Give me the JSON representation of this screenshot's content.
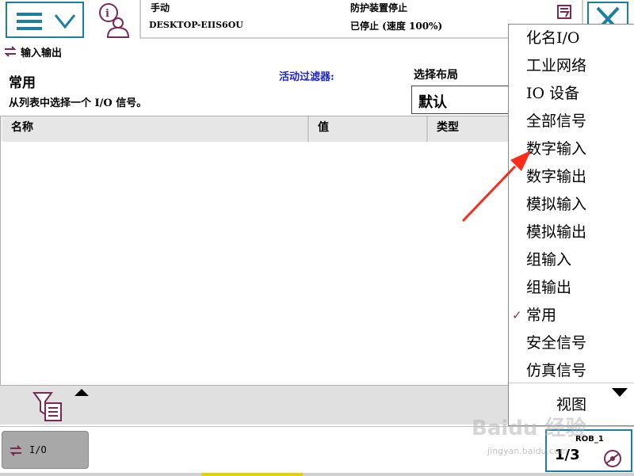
{
  "topbar": {
    "mode": "手动",
    "controller": "DESKTOP-EIIS6OU",
    "protection": "防护装置停止",
    "state_speed": "已停止 (速度 100%)"
  },
  "breadcrumb": {
    "title": "输入输出"
  },
  "header": {
    "view_title": "常用",
    "description": "从列表中选择一个 I/O 信号。",
    "filter_label": "活动过滤器:",
    "layout_label": "选择布局",
    "layout_value": "默认"
  },
  "table": {
    "columns": [
      "名称",
      "值",
      "类型"
    ],
    "rows": []
  },
  "dropdown": {
    "items": [
      {
        "label": "化名I/O",
        "checked": false
      },
      {
        "label": "工业网络",
        "checked": false
      },
      {
        "label": "IO 设备",
        "checked": false
      },
      {
        "label": "全部信号",
        "checked": false
      },
      {
        "label": "数字输入",
        "checked": false
      },
      {
        "label": "数字输出",
        "checked": false
      },
      {
        "label": "模拟输入",
        "checked": false
      },
      {
        "label": "模拟输出",
        "checked": false
      },
      {
        "label": "组输入",
        "checked": false
      },
      {
        "label": "组输出",
        "checked": false
      },
      {
        "label": "常用",
        "checked": true
      },
      {
        "label": "安全信号",
        "checked": false
      },
      {
        "label": "仿真信号",
        "checked": false
      }
    ],
    "check_mark": "✓",
    "view_label": "视图"
  },
  "taskbar": {
    "io_task_label": "I/O",
    "robot_id": "ROB_1",
    "ratio": "1/3"
  },
  "watermark": {
    "brand": "Baidu 经验",
    "url": "jingyan.baidu.com"
  },
  "colors": {
    "accent": "#1b7fa0",
    "filter_label": "#1d24d8",
    "check": "#8a2d5a",
    "annotation_arrow": "#ff2a1a"
  },
  "icons": [
    "menu-icon",
    "chevron-down-icon",
    "info-user-icon",
    "status-icon",
    "close-icon",
    "io-icon",
    "filter-icon",
    "scroll-up-icon",
    "scroll-down-icon",
    "speed-icon"
  ]
}
